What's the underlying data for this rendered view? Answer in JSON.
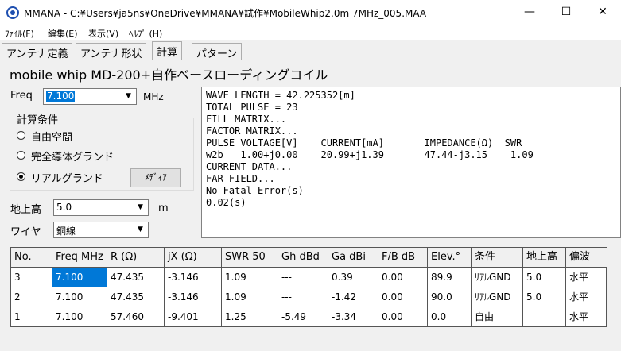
{
  "window": {
    "title": "MMANA - C:¥Users¥ja5ns¥OneDrive¥MMANA¥試作¥MobileWhip2.0m 7MHz_005.MAA",
    "minimize": "—",
    "maximize": "☐",
    "close": "✕"
  },
  "menu": [
    "ﾌｧｲﾙ(F)",
    "編集(E)",
    "表示(V)",
    "ﾍﾙﾌﾟ (H)"
  ],
  "tabs": [
    "アンテナ定義",
    "アンテナ形状",
    "計算",
    "パターン"
  ],
  "active_tab": 2,
  "antenna_name": "mobile whip  MD-200+自作ベースローディングコイル",
  "freq": {
    "label": "Freq",
    "value": "7.100",
    "unit": "MHz"
  },
  "calc_conditions": {
    "title": "計算条件",
    "options": [
      "自由空間",
      "完全導体グランド",
      "リアルグランド"
    ],
    "selected": 2,
    "media_button": "ﾒﾃﾞｨｱ"
  },
  "height": {
    "label": "地上高",
    "value": "5.0",
    "unit": "m"
  },
  "wire": {
    "label": "ワイヤ",
    "value": "銅線"
  },
  "output_lines": [
    "WAVE LENGTH = 42.225352[m]",
    "TOTAL PULSE = 23",
    "FILL MATRIX...",
    "FACTOR MATRIX...",
    "PULSE VOLTAGE[V]    CURRENT[mA]       IMPEDANCE(Ω)  SWR",
    "w2b   1.00+j0.00    20.99+j1.39       47.44-j3.15    1.09",
    "CURRENT DATA...",
    "FAR FIELD...",
    "No Fatal Error(s)",
    "0.02(s)"
  ],
  "table": {
    "headers": [
      "No.",
      "Freq MHz",
      "R (Ω)",
      "jX (Ω)",
      "SWR 50",
      "Gh dBd",
      "Ga dBi",
      "F/B dB",
      "Elev.°",
      "条件",
      "地上高",
      "偏波"
    ],
    "rows": [
      [
        "3",
        "7.100",
        "47.435",
        "-3.146",
        "1.09",
        "---",
        "0.39",
        "0.00",
        "89.9",
        "ﾘｱﾙGND",
        "5.0",
        "水平"
      ],
      [
        "2",
        "7.100",
        "47.435",
        "-3.146",
        "1.09",
        "---",
        "-1.42",
        "0.00",
        "90.0",
        "ﾘｱﾙGND",
        "5.0",
        "水平"
      ],
      [
        "1",
        "7.100",
        "57.460",
        "-9.401",
        "1.25",
        "-5.49",
        "-3.34",
        "0.00",
        "0.0",
        "自由",
        "",
        "水平"
      ]
    ],
    "selected_cell": {
      "row": 0,
      "col": 1
    }
  }
}
